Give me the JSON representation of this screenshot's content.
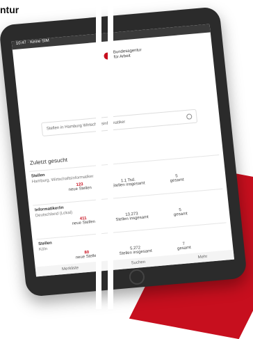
{
  "brand": {
    "word_fragment": "ntur"
  },
  "tablet": {
    "status_left": "10:47 · Keine SIM",
    "logo_lines": [
      "Bundesagentur",
      "für Arbeit"
    ],
    "search": {
      "placeholder": "Stellen in Hamburg Wirtschaftsinformatiker",
      "icon": "search-icon"
    },
    "section_title": "Zuletzt gesucht",
    "cards": [
      {
        "title": "Stellen",
        "subtitle": "Hamburg, Wirtschaftsinformatiker",
        "col1_num": "123",
        "col1_label": "neue Stellen",
        "col2_num": "1.1 Tsd.",
        "col2_label": "Stellen insgesamt",
        "col3_num": "5",
        "col3_label": "gesamt"
      },
      {
        "title": "Informatiker/in",
        "subtitle": "Deutschland (Lokal)",
        "col1_num": "411",
        "col1_label": "neue Stellen",
        "col2_num": "13.273",
        "col2_label": "Stellen insgesamt",
        "col3_num": "5",
        "col3_label": "gesamt"
      },
      {
        "title": "Stellen",
        "subtitle": "Köln",
        "col1_num": "80",
        "col1_label": "neue Stellen",
        "col2_num": "5.272",
        "col2_label": "Stellen insgesamt",
        "col3_num": "7",
        "col3_label": "gesamt"
      }
    ],
    "bottom_nav": [
      "Merkliste",
      "Suchen",
      "Mehr"
    ]
  },
  "colors": {
    "accent": "#c70f1e"
  }
}
